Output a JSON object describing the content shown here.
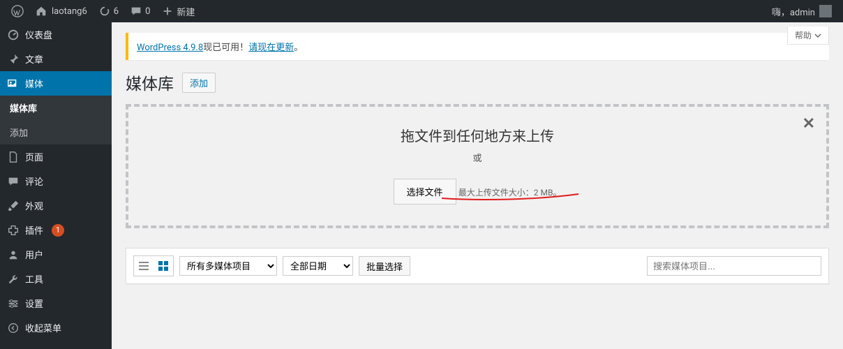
{
  "adminbar": {
    "site_name": "laotang6",
    "updates_count": "6",
    "comments_count": "0",
    "new_label": "新建",
    "greeting": "嗨，admin"
  },
  "sidebar": {
    "dashboard": "仪表盘",
    "posts": "文章",
    "media": "媒体",
    "media_library": "媒体库",
    "media_add": "添加",
    "pages": "页面",
    "comments": "评论",
    "appearance": "外观",
    "plugins": "插件",
    "plugins_badge": "1",
    "users": "用户",
    "tools": "工具",
    "settings": "设置",
    "collapse": "收起菜单"
  },
  "help_label": "帮助",
  "notice": {
    "link1": "WordPress 4.9.8",
    "text1": "现已可用！",
    "link2": "请现在更新",
    "text2": "。"
  },
  "heading": {
    "title": "媒体库",
    "add": "添加"
  },
  "uploader": {
    "drop_text": "拖文件到任何地方来上传",
    "or": "或",
    "select_file": "选择文件",
    "max_size": "最大上传文件大小：2 MB。"
  },
  "filter": {
    "type_all": "所有多媒体项目",
    "date_all": "全部日期",
    "bulk": "批量选择",
    "search_placeholder": "搜索媒体项目..."
  }
}
